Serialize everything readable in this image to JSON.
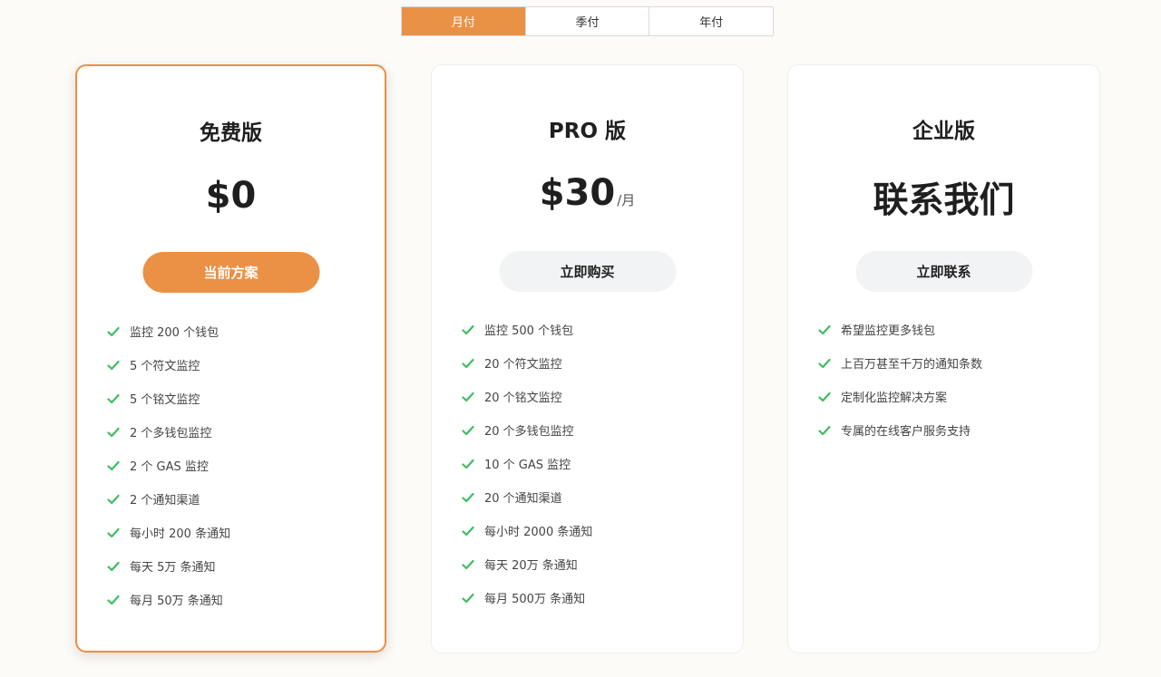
{
  "billing": {
    "tabs": [
      {
        "label": "月付",
        "active": true
      },
      {
        "label": "季付",
        "active": false
      },
      {
        "label": "年付",
        "active": false
      }
    ]
  },
  "colors": {
    "accent": "#ea9146",
    "check": "#3dbd5e",
    "background": "#fdfbf7"
  },
  "plans": [
    {
      "name": "免费版",
      "price": "$0",
      "unit": "",
      "cta": "当前方案",
      "current": true,
      "features": [
        "监控 200 个钱包",
        "5 个符文监控",
        "5 个铭文监控",
        "2 个多钱包监控",
        "2 个 GAS 监控",
        "2 个通知渠道",
        "每小时 200 条通知",
        "每天 5万 条通知",
        "每月 50万 条通知"
      ]
    },
    {
      "name": "PRO 版",
      "price": "$30",
      "unit": "/月",
      "cta": "立即购买",
      "current": false,
      "features": [
        "监控 500 个钱包",
        "20 个符文监控",
        "20 个铭文监控",
        "20 个多钱包监控",
        "10 个 GAS 监控",
        "20 个通知渠道",
        "每小时 2000 条通知",
        "每天 20万 条通知",
        "每月 500万 条通知"
      ]
    },
    {
      "name": "企业版",
      "price": "联系我们",
      "unit": "",
      "cta": "立即联系",
      "current": false,
      "features": [
        "希望监控更多钱包",
        "上百万甚至千万的通知条数",
        "定制化监控解决方案",
        "专属的在线客户服务支持"
      ]
    }
  ],
  "icons": {
    "feature": "check-icon"
  }
}
